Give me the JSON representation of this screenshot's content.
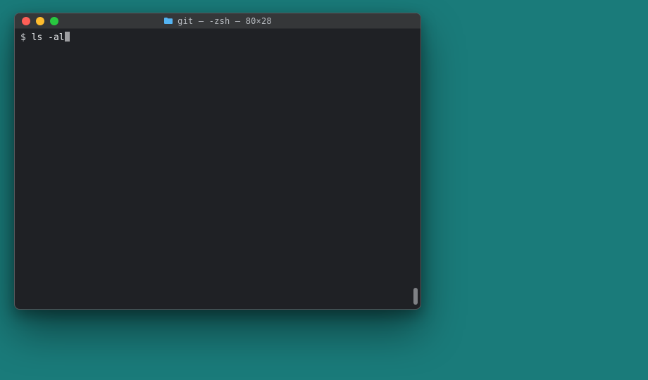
{
  "window": {
    "title": "git — -zsh — 80×28",
    "folder_icon": "folder-icon"
  },
  "traffic_lights": {
    "close": "close",
    "minimize": "minimize",
    "maximize": "maximize"
  },
  "terminal": {
    "prompt_symbol": "$ ",
    "command": "ls -al"
  }
}
